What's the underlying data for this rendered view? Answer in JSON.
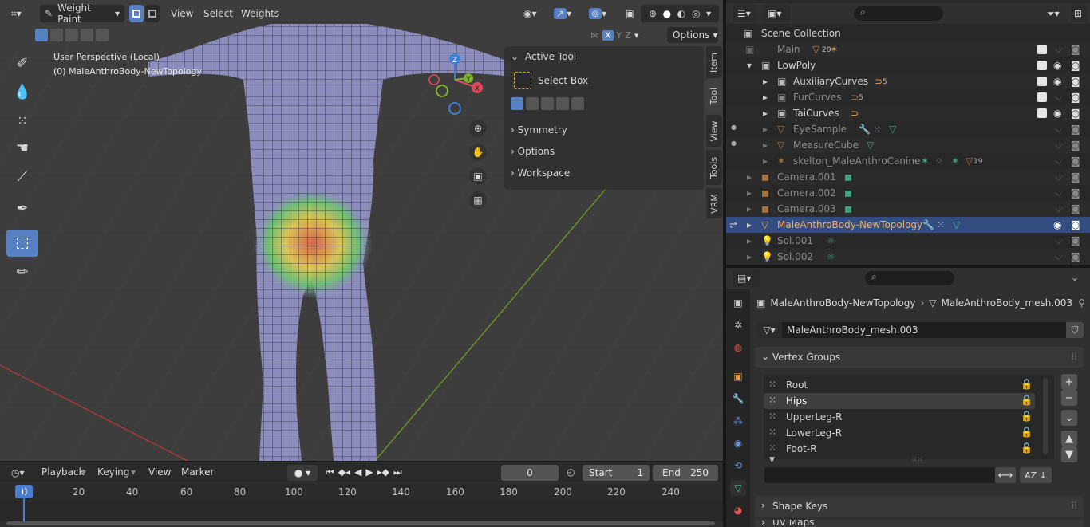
{
  "viewport": {
    "mode": "Weight Paint",
    "menus": [
      "View",
      "Select",
      "Weights"
    ],
    "options_label": "Options",
    "axes": [
      "X",
      "Y",
      "Z"
    ],
    "overlay_line1": "User Perspective (Local)",
    "overlay_line2": "(0) MaleAnthroBody-NewTopology",
    "gizmo": {
      "x": "X",
      "y": "Y",
      "z": "Z"
    }
  },
  "active_tool_panel": {
    "title": "Active Tool",
    "tool_name": "Select Box",
    "sections": [
      "Symmetry",
      "Options",
      "Workspace"
    ]
  },
  "side_tabs": [
    "Item",
    "Tool",
    "View",
    "Tools",
    "VRM"
  ],
  "timeline": {
    "menus": [
      "Playback",
      "Keying",
      "View",
      "Marker"
    ],
    "current_frame": "0",
    "start_label": "Start",
    "start_value": "1",
    "end_label": "End",
    "end_value": "250",
    "ruler_ticks": [
      "0",
      "20",
      "40",
      "60",
      "80",
      "100",
      "120",
      "140",
      "160",
      "180",
      "200",
      "220",
      "240"
    ]
  },
  "outliner": {
    "root": "Scene Collection",
    "rows": [
      {
        "name": "Main",
        "badge": "20"
      },
      {
        "name": "LowPoly",
        "badge": ""
      },
      {
        "name": "AuxiliaryCurves",
        "badge": "5"
      },
      {
        "name": "FurCurves",
        "badge": "5"
      },
      {
        "name": "TaiCurves",
        "badge": ""
      },
      {
        "name": "EyeSample",
        "badge": ""
      },
      {
        "name": "MeasureCube",
        "badge": ""
      },
      {
        "name": "skelton_MaleAnthroCanine",
        "badge": "19"
      },
      {
        "name": "Camera.001",
        "badge": ""
      },
      {
        "name": "Camera.002",
        "badge": ""
      },
      {
        "name": "Camera.003",
        "badge": ""
      },
      {
        "name": "MaleAnthroBody-NewTopology",
        "badge": ""
      },
      {
        "name": "Sol.001",
        "badge": ""
      },
      {
        "name": "Sol.002",
        "badge": ""
      }
    ]
  },
  "properties": {
    "breadcrumb_object": "MaleAnthroBody-NewTopology",
    "breadcrumb_mesh": "MaleAnthroBody_mesh.003",
    "mesh_name": "MaleAnthroBody_mesh.003",
    "vertex_groups_title": "Vertex Groups",
    "vertex_groups": [
      "Root",
      "Hips",
      "UpperLeg-R",
      "LowerLeg-R",
      "Foot-R"
    ],
    "shape_keys_title": "Shape Keys",
    "uv_maps_title": "UV Maps"
  },
  "colors": {
    "selection_blue": "#334d80",
    "active_tool_blue": "#5680c2",
    "axis_x": "#e04a5a",
    "axis_y": "#79b32b",
    "axis_z": "#3d7fd6",
    "object_orange": "#e9a24e"
  }
}
